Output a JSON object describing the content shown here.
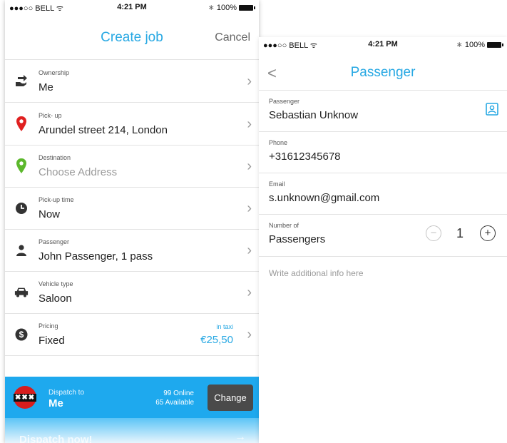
{
  "left_screen": {
    "status": {
      "carrier": "●●●○○ BELL ᯤ",
      "time": "4:21 PM",
      "bt": "∗",
      "battery": "100%"
    },
    "title": "Create job",
    "cancel_label": "Cancel",
    "rows": [
      {
        "label": "Ownership",
        "value": "Me",
        "icon": "hand-arrow-icon"
      },
      {
        "label": "Pick- up",
        "value": "Arundel street 214, London",
        "icon": "red-pin-icon"
      },
      {
        "label": "Destination",
        "value": "Choose Address",
        "icon": "green-pin-icon"
      },
      {
        "label": "Pick-up time",
        "value": "Now",
        "icon": "clock-icon"
      },
      {
        "label": "Passenger",
        "value": "John Passenger, 1 pass",
        "icon": "person-icon"
      },
      {
        "label": "Vehicle type",
        "value": "Saloon",
        "icon": "car-icon"
      },
      {
        "label": "Pricing",
        "value": "Fixed",
        "icon": "dollar-icon",
        "note": "in taxi",
        "price": "€25,50"
      }
    ],
    "dispatch": {
      "logo_text": "✖✖✖",
      "to_label": "Dispatch to",
      "to_value": "Me",
      "online": "99 Online",
      "available": "65 Available",
      "change_label": "Change",
      "dispatch_now_label": "Dispatch now!",
      "arrow": "→"
    }
  },
  "right_screen": {
    "status": {
      "carrier": "●●●○○ BELL ᯤ",
      "time": "4:21 PM",
      "bt": "∗",
      "battery": "100%"
    },
    "back": "<",
    "title": "Passenger",
    "fields": [
      {
        "label": "Passenger",
        "value": "Sebastian Unknow"
      },
      {
        "label": "Phone",
        "value": "+31612345678"
      },
      {
        "label": "Email",
        "value": "s.unknown@gmail.com"
      },
      {
        "label": "Number of",
        "value": "Passengers"
      }
    ],
    "stepper": {
      "minus": "−",
      "value": "1",
      "plus": "+"
    },
    "notes_placeholder": "Write additional info here"
  },
  "colors": {
    "accent": "#27a8e3",
    "dispatch_bar": "#1ea9ee",
    "pin_red": "#e02020",
    "pin_green": "#5cb82c",
    "change_button": "#4a4a4a"
  }
}
